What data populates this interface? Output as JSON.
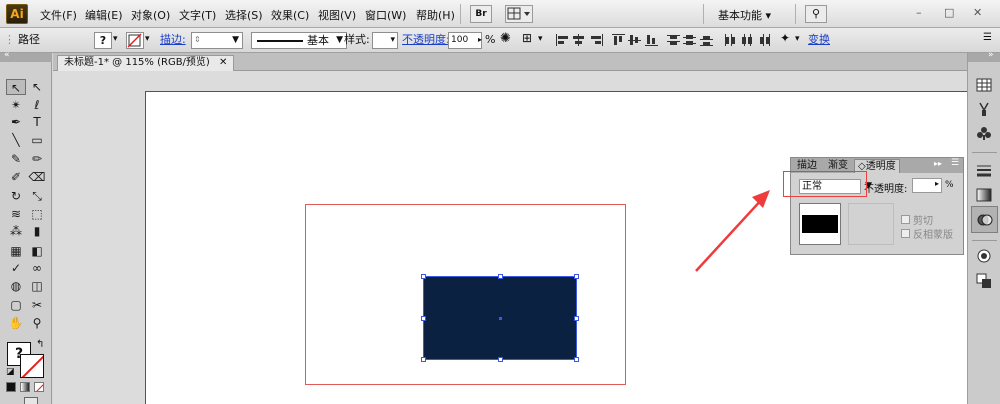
{
  "app": {
    "logo": "Ai"
  },
  "menu": [
    "文件(F)",
    "编辑(E)",
    "对象(O)",
    "文字(T)",
    "选择(S)",
    "效果(C)",
    "视图(V)",
    "窗口(W)",
    "帮助(H)"
  ],
  "menubar": {
    "br_label": "Br",
    "workspace": "基本功能",
    "win_minimize": "–",
    "win_restore": "□",
    "win_close": "✕",
    "inner_minimize": "–",
    "inner_restore": "□",
    "inner_close": "✕"
  },
  "controlbar": {
    "selection_type": "路径",
    "fill_label": "?",
    "stroke_label": "描边:",
    "stroke_style": "基本",
    "style_label": "样式:",
    "opacity_label": "不透明度:",
    "opacity_value": "100",
    "percent": "%",
    "transform_label": "变换"
  },
  "document": {
    "tab_title": "未标题-1* @ 115% (RGB/预览)",
    "close": "✕"
  },
  "tools": [
    [
      "selection-tool",
      "↖"
    ],
    [
      "direct-selection-tool",
      "↖"
    ],
    [
      "magic-wand-tool",
      "✴"
    ],
    [
      "lasso-tool",
      "ℓ"
    ],
    [
      "pen-tool",
      "✒"
    ],
    [
      "type-tool",
      "T"
    ],
    [
      "line-segment-tool",
      "╲"
    ],
    [
      "rectangle-tool",
      "▭"
    ],
    [
      "paintbrush-tool",
      "✎"
    ],
    [
      "pencil-tool",
      "✏"
    ],
    [
      "blob-brush-tool",
      "✐"
    ],
    [
      "eraser-tool",
      "⌫"
    ],
    [
      "rotate-tool",
      "↻"
    ],
    [
      "scale-tool",
      "⤡"
    ],
    [
      "warp-tool",
      "≋"
    ],
    [
      "free-transform-tool",
      "⬚"
    ],
    [
      "symbol-sprayer-tool",
      "⁂"
    ],
    [
      "column-graph-tool",
      "▮"
    ],
    [
      "mesh-tool",
      "▦"
    ],
    [
      "gradient-tool",
      "◧"
    ],
    [
      "eyedropper-tool",
      "✓"
    ],
    [
      "blend-tool",
      "∞"
    ],
    [
      "live-paint-bucket-tool",
      "◍"
    ],
    [
      "live-paint-selection-tool",
      "◫"
    ],
    [
      "artboard-tool",
      "▢"
    ],
    [
      "slice-tool",
      "✂"
    ],
    [
      "hand-tool",
      "✋"
    ],
    [
      "zoom-tool",
      "⚲"
    ]
  ],
  "transparency_panel": {
    "tabs": [
      "描边",
      "渐变",
      "◇透明度"
    ],
    "blend_mode": "正常",
    "opacity_label": "不透明度:",
    "percent": "%",
    "clip_label": "剪切",
    "invert_mask_label": "反相蒙版"
  },
  "colors": {
    "rect_fill": "#0b2141",
    "selection_blue": "#3c5ae0",
    "annotation_red": "#ef4040",
    "guide_red": "#e05a5a"
  }
}
